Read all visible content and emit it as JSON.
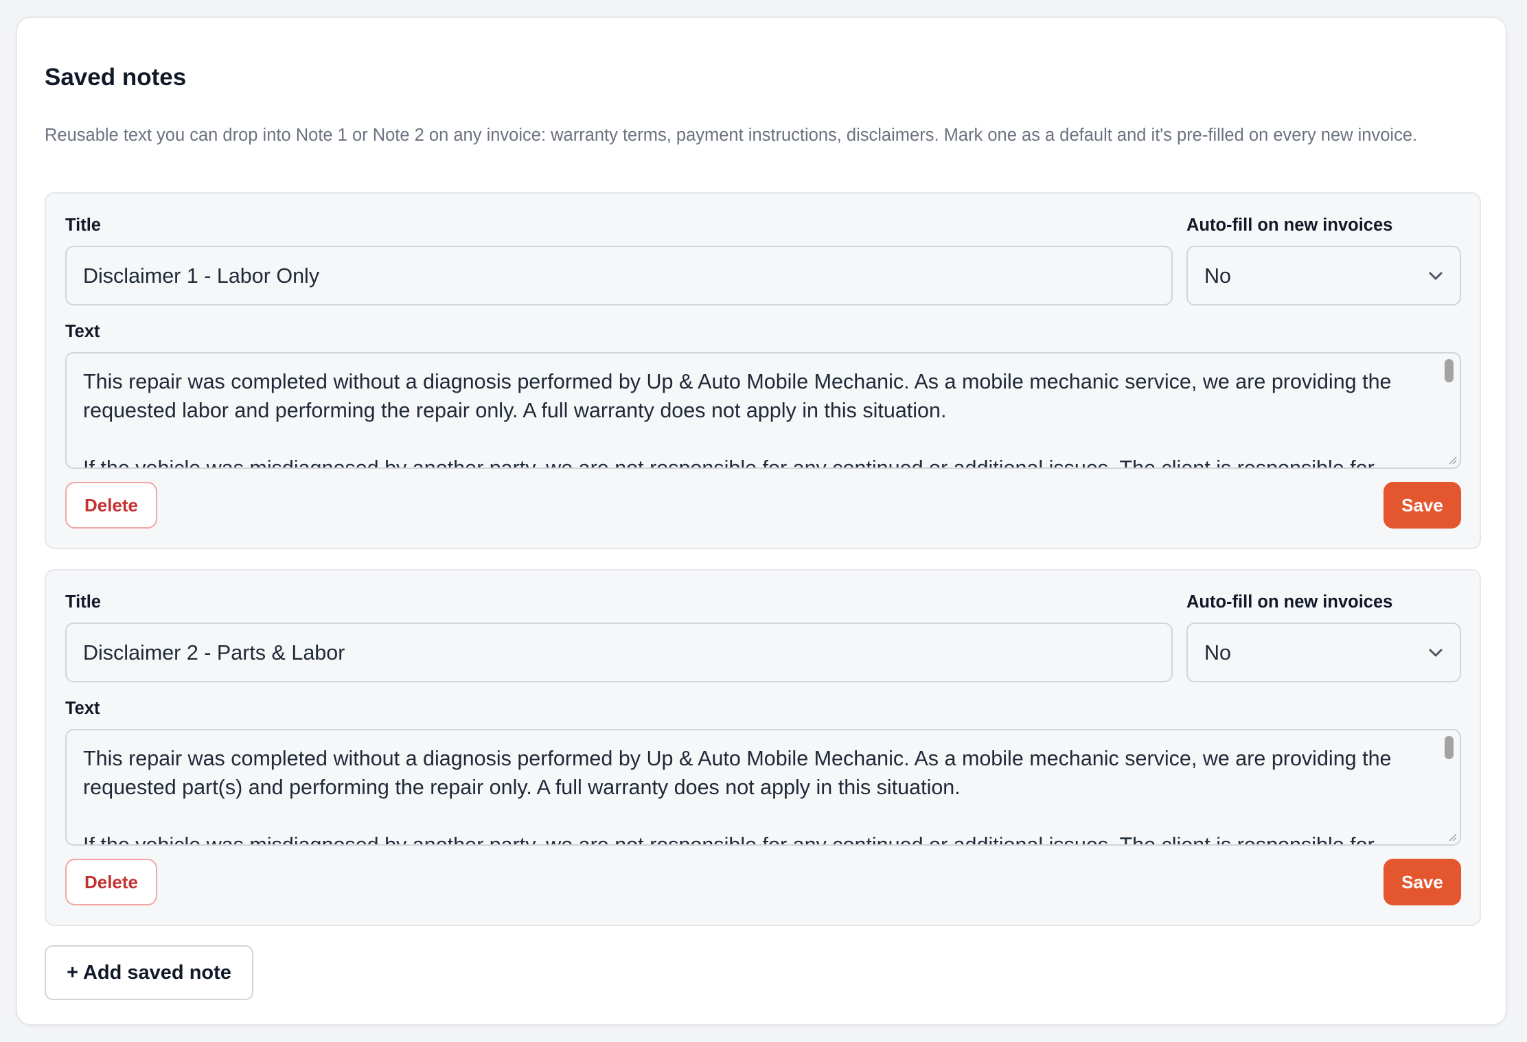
{
  "section": {
    "title": "Saved notes",
    "description": "Reusable text you can drop into Note 1 or Note 2 on any invoice: warranty terms, payment instructions, disclaimers. Mark one as a default and it's pre-filled on every new invoice."
  },
  "labels": {
    "title": "Title",
    "autofill": "Auto-fill on new invoices",
    "text": "Text"
  },
  "notes": [
    {
      "title_value": "Disclaimer 1 - Labor Only",
      "autofill_value": "No",
      "text_value": "This repair was completed without a diagnosis performed by Up & Auto Mobile Mechanic. As a mobile mechanic service, we are providing the requested labor and performing the repair only. A full warranty does not apply in this situation.\n\nIf the vehicle was misdiagnosed by another party, we are not responsible for any continued or additional issues. The client is responsible for",
      "delete_label": "Delete",
      "save_label": "Save"
    },
    {
      "title_value": "Disclaimer 2 - Parts & Labor",
      "autofill_value": "No",
      "text_value": "This repair was completed without a diagnosis performed by Up & Auto Mobile Mechanic. As a mobile mechanic service, we are providing the requested part(s) and performing the repair only. A full warranty does not apply in this situation.\n\nIf the vehicle was misdiagnosed by another party, we are not responsible for any continued or additional issues. The client is responsible for",
      "delete_label": "Delete",
      "save_label": "Save"
    }
  ],
  "add_button_label": "+ Add saved note",
  "colors": {
    "accent": "#e4572e",
    "danger": "#c53030"
  },
  "icons": {
    "select_arrow": "chevron-down-icon"
  }
}
